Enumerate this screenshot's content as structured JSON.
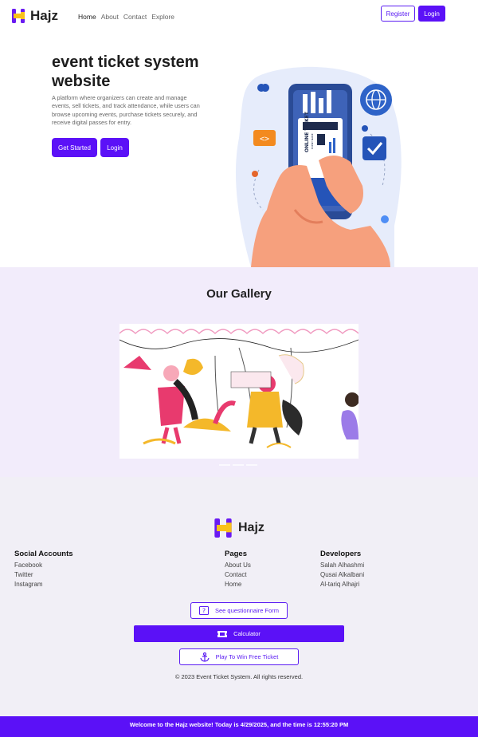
{
  "brand": {
    "name": "Hajz"
  },
  "nav": {
    "links": [
      "Home",
      "About",
      "Contact",
      "Explore"
    ],
    "register_label": "Register",
    "login_label": "Login"
  },
  "hero": {
    "title": "event ticket system website",
    "description": "A platform where organizers can create and manage events, sell tickets, and track attendance, while users can browse upcoming events, purchase tickets securely, and receive digital passes for entry.",
    "primary_label": "Get Started",
    "secondary_label": "Login",
    "ticket_text": "ONLINE TICKET",
    "ticket_subtext": "EVENT NAME"
  },
  "gallery": {
    "title": "Our Gallery"
  },
  "footer": {
    "social": {
      "heading": "Social Accounts",
      "items": [
        "Facebook",
        "Twitter",
        "Instagram"
      ]
    },
    "pages": {
      "heading": "Pages",
      "items": [
        "About Us",
        "Contact",
        "Home"
      ]
    },
    "developers": {
      "heading": "Developers",
      "items": [
        "Salah Alhashmi",
        "Qusai Alkalbani",
        "Al-tariq Alhajri"
      ]
    },
    "questionnaire_label": "See questionnaire Form",
    "calculator_label": "Calculator",
    "play_label": "Play To Win Free Ticket",
    "copyright": "© 2023 Event Ticket System. All rights reserved."
  },
  "banner": {
    "text": "Welcome to the Hajz website! Today is 4/29/2025, and the time is 12:55:20 PM"
  },
  "colors": {
    "accent": "#5b11f7",
    "logo_yellow": "#f9c21a"
  }
}
